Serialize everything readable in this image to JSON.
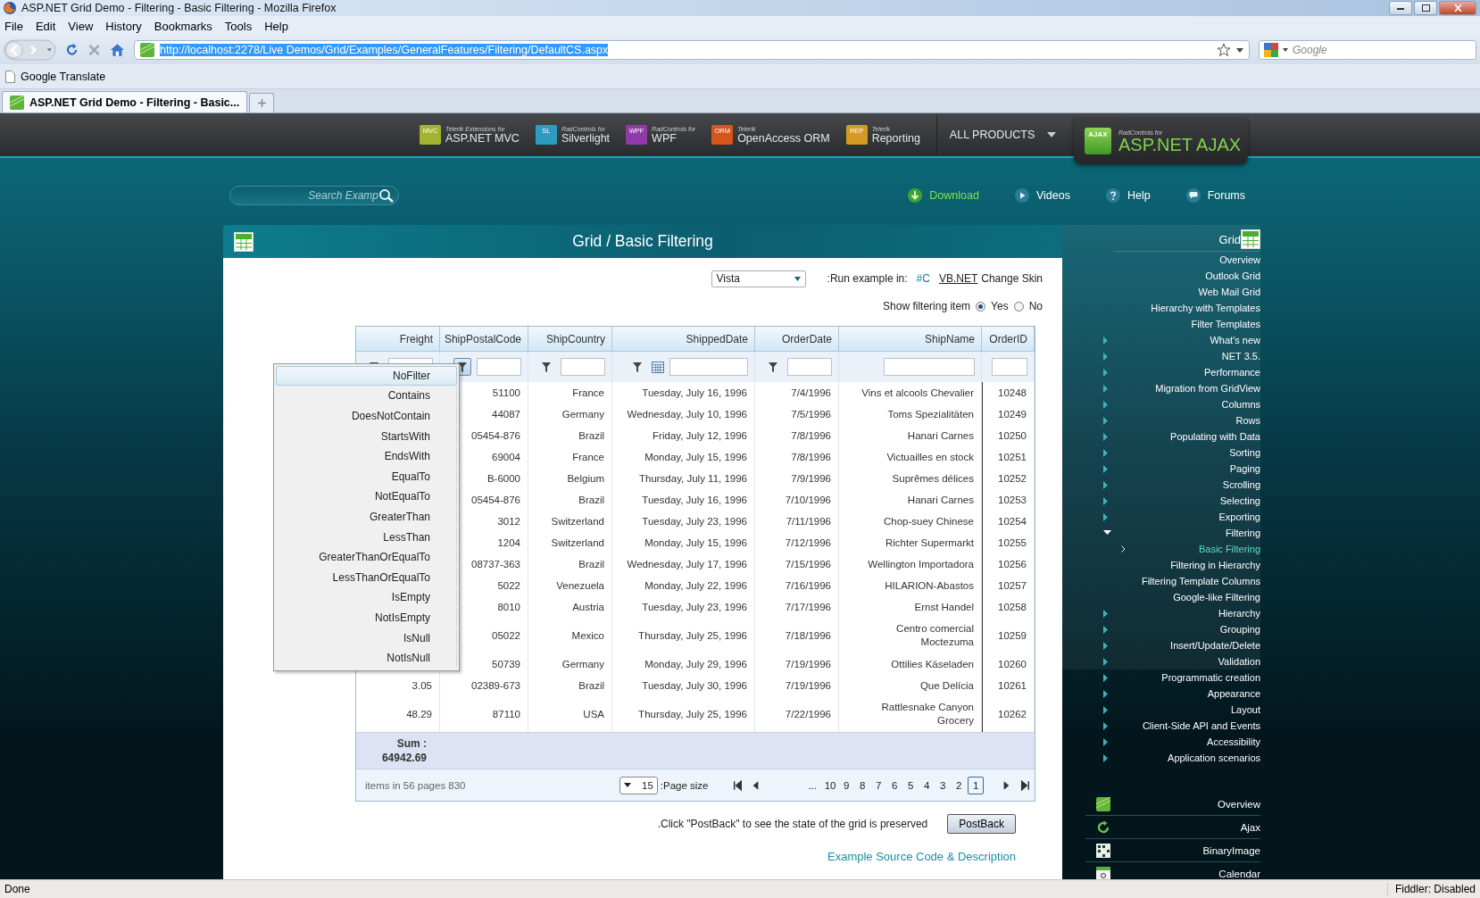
{
  "browser": {
    "title": "ASP.NET Grid Demo - Filtering - Basic Filtering - Mozilla Firefox",
    "menu": [
      "File",
      "Edit",
      "View",
      "History",
      "Bookmarks",
      "Tools",
      "Help"
    ],
    "url": "http://localhost:2278/Live Demos/Grid/Examples/GeneralFeatures/Filtering/DefaultCS.aspx",
    "search_placeholder": "Google",
    "bookmarks": [
      "Google Translate"
    ],
    "tabs": [
      {
        "label": "ASP.NET Grid Demo - Filtering - Basic...",
        "selected": true
      }
    ],
    "status": "Done",
    "status_right": "Fiddler: Disabled"
  },
  "products": [
    {
      "badge": "MVC",
      "color": "#a3b530",
      "caption": "Telerik Extensions for",
      "name": "ASP.NET MVC"
    },
    {
      "badge": "SL",
      "color": "#2e9cc0",
      "caption": "RadControls for",
      "name": "Silverlight"
    },
    {
      "badge": "WPF",
      "color": "#8f3aa8",
      "caption": "RadControls for",
      "name": "WPF"
    },
    {
      "badge": "ORM",
      "color": "#d5561c",
      "caption": "Telerik",
      "name": "OpenAccess ORM"
    },
    {
      "badge": "REP",
      "color": "#d49a22",
      "caption": "Telerik",
      "name": "Reporting"
    }
  ],
  "all_products": "ALL PRODUCTS",
  "brand": {
    "badge": "AJAX",
    "caption": "RadControls for",
    "name": "ASP.NET AJAX"
  },
  "search": {
    "placeholder": "Search Examp"
  },
  "links": [
    {
      "label": "Download",
      "kind": "download"
    },
    {
      "label": "Videos",
      "kind": "videos"
    },
    {
      "label": "Help",
      "kind": "help"
    },
    {
      "label": "Forums",
      "kind": "forums"
    }
  ],
  "panel": {
    "title": "Grid / Basic Filtering",
    "skin": "Vista",
    "run_label": ":Run example in:",
    "languages": [
      {
        "label": "#C",
        "selected": true
      },
      {
        "label": "VB.NET",
        "selected": false
      }
    ],
    "change_skin": "Change Skin",
    "filter_label": "Show filtering item",
    "filter_options": [
      {
        "label": "Yes",
        "selected": true
      },
      {
        "label": "No",
        "selected": false
      }
    ]
  },
  "grid": {
    "columns": [
      "Freight",
      "ShipPostalCode",
      "ShipCountry",
      "ShippedDate",
      "OrderDate",
      "ShipName",
      "OrderID"
    ],
    "filters": [
      {
        "kind": "text",
        "active": false
      },
      {
        "kind": "text",
        "active": true
      },
      {
        "kind": "text",
        "active": false
      },
      {
        "kind": "date",
        "active": false
      },
      {
        "kind": "text",
        "active": false
      },
      {
        "kind": "plain"
      },
      {
        "kind": "plain"
      }
    ],
    "rows": [
      {
        "ship_postal_code": "51100",
        "ship_country": "France",
        "shipped_date": "Tuesday, July 16, 1996",
        "order_date": "7/4/1996",
        "ship_name": "Vins et alcools Chevalier",
        "order_id": "10248"
      },
      {
        "ship_postal_code": "44087",
        "ship_country": "Germany",
        "shipped_date": "Wednesday, July 10, 1996",
        "order_date": "7/5/1996",
        "ship_name": "Toms Spezialitäten",
        "order_id": "10249"
      },
      {
        "ship_postal_code": "05454-876",
        "ship_country": "Brazil",
        "shipped_date": "Friday, July 12, 1996",
        "order_date": "7/8/1996",
        "ship_name": "Hanari Carnes",
        "order_id": "10250"
      },
      {
        "ship_postal_code": "69004",
        "ship_country": "France",
        "shipped_date": "Monday, July 15, 1996",
        "order_date": "7/8/1996",
        "ship_name": "Victuailles en stock",
        "order_id": "10251"
      },
      {
        "ship_postal_code": "B-6000",
        "ship_country": "Belgium",
        "shipped_date": "Thursday, July 11, 1996",
        "order_date": "7/9/1996",
        "ship_name": "Suprêmes délices",
        "order_id": "10252"
      },
      {
        "ship_postal_code": "05454-876",
        "ship_country": "Brazil",
        "shipped_date": "Tuesday, July 16, 1996",
        "order_date": "7/10/1996",
        "ship_name": "Hanari Carnes",
        "order_id": "10253"
      },
      {
        "ship_postal_code": "3012",
        "ship_country": "Switzerland",
        "shipped_date": "Tuesday, July 23, 1996",
        "order_date": "7/11/1996",
        "ship_name": "Chop-suey Chinese",
        "order_id": "10254"
      },
      {
        "ship_postal_code": "1204",
        "ship_country": "Switzerland",
        "shipped_date": "Monday, July 15, 1996",
        "order_date": "7/12/1996",
        "ship_name": "Richter Supermarkt",
        "order_id": "10255"
      },
      {
        "ship_postal_code": "08737-363",
        "ship_country": "Brazil",
        "shipped_date": "Wednesday, July 17, 1996",
        "order_date": "7/15/1996",
        "ship_name": "Wellington Importadora",
        "order_id": "10256"
      },
      {
        "ship_postal_code": "5022",
        "ship_country": "Venezuela",
        "shipped_date": "Monday, July 22, 1996",
        "order_date": "7/16/1996",
        "ship_name": "HILARION-Abastos",
        "order_id": "10257"
      },
      {
        "ship_postal_code": "8010",
        "ship_country": "Austria",
        "shipped_date": "Tuesday, July 23, 1996",
        "order_date": "7/17/1996",
        "ship_name": "Ernst Handel",
        "order_id": "10258"
      },
      {
        "ship_postal_code": "05022",
        "ship_country": "Mexico",
        "shipped_date": "Thursday, July 25, 1996",
        "order_date": "7/18/1996",
        "ship_name": "Centro comercial Moctezuma",
        "order_id": "10259"
      },
      {
        "ship_postal_code": "50739",
        "ship_country": "Germany",
        "shipped_date": "Monday, July 29, 1996",
        "order_date": "7/19/1996",
        "ship_name": "Ottilies Käseladen",
        "order_id": "10260"
      },
      {
        "freight": "3.05",
        "ship_postal_code": "02389-673",
        "ship_country": "Brazil",
        "shipped_date": "Tuesday, July 30, 1996",
        "order_date": "7/19/1996",
        "ship_name": "Que Delícia",
        "order_id": "10261"
      },
      {
        "freight": "48.29",
        "ship_postal_code": "87110",
        "ship_country": "USA",
        "shipped_date": "Thursday, July 25, 1996",
        "order_date": "7/22/1996",
        "ship_name": "Rattlesnake Canyon Grocery",
        "order_id": "10262"
      }
    ],
    "sum": {
      "label": "Sum :",
      "value": "64942.69"
    },
    "pager": {
      "summary": "items in 56 pages 830",
      "page_size": "15",
      "page_size_label": ":Page size",
      "ellipsis": "...",
      "pages": [
        {
          "label": "10",
          "selected": false
        },
        {
          "label": "9",
          "selected": false
        },
        {
          "label": "8",
          "selected": false
        },
        {
          "label": "7",
          "selected": false
        },
        {
          "label": "6",
          "selected": false
        },
        {
          "label": "5",
          "selected": false
        },
        {
          "label": "4",
          "selected": false
        },
        {
          "label": "3",
          "selected": false
        },
        {
          "label": "2",
          "selected": false
        },
        {
          "label": "1",
          "selected": true
        }
      ]
    }
  },
  "filter_menu": [
    {
      "label": "NoFilter",
      "selected": true
    },
    {
      "label": "Contains",
      "selected": false
    },
    {
      "label": "DoesNotContain",
      "selected": false
    },
    {
      "label": "StartsWith",
      "selected": false
    },
    {
      "label": "EndsWith",
      "selected": false
    },
    {
      "label": "EqualTo",
      "selected": false
    },
    {
      "label": "NotEqualTo",
      "selected": false
    },
    {
      "label": "GreaterThan",
      "selected": false
    },
    {
      "label": "LessThan",
      "selected": false
    },
    {
      "label": "GreaterThanOrEqualTo",
      "selected": false
    },
    {
      "label": "LessThanOrEqualTo",
      "selected": false
    },
    {
      "label": "IsEmpty",
      "selected": false
    },
    {
      "label": "NotIsEmpty",
      "selected": false
    },
    {
      "label": "IsNull",
      "selected": false
    },
    {
      "label": "NotIsNull",
      "selected": false
    }
  ],
  "postback": {
    "text": ".Click \"PostBack\" to see the state of the grid is preserved",
    "button": "PostBack"
  },
  "source_link": "Example Source Code & Description",
  "sidebar": {
    "title": "Grid",
    "items": [
      {
        "label": "Overview",
        "kind": "leaf",
        "selected": false
      },
      {
        "label": "Outlook Grid",
        "kind": "leaf",
        "selected": false
      },
      {
        "label": "Web Mail Grid",
        "kind": "leaf",
        "selected": false
      },
      {
        "label": "Hierarchy with Templates",
        "kind": "leaf",
        "selected": false
      },
      {
        "label": "Filter Templates",
        "kind": "leaf",
        "selected": false
      },
      {
        "label": "What's new",
        "kind": "group",
        "expanded": false,
        "selected": false
      },
      {
        "label": "NET 3.5.",
        "kind": "group",
        "expanded": false,
        "selected": false
      },
      {
        "label": "Performance",
        "kind": "group",
        "expanded": false,
        "selected": false
      },
      {
        "label": "Migration from GridView",
        "kind": "group",
        "expanded": false,
        "selected": false
      },
      {
        "label": "Columns",
        "kind": "group",
        "expanded": false,
        "selected": false
      },
      {
        "label": "Rows",
        "kind": "group",
        "expanded": false,
        "selected": false
      },
      {
        "label": "Populating with Data",
        "kind": "group",
        "expanded": false,
        "selected": false
      },
      {
        "label": "Sorting",
        "kind": "group",
        "expanded": false,
        "selected": false
      },
      {
        "label": "Paging",
        "kind": "group",
        "expanded": false,
        "selected": false
      },
      {
        "label": "Scrolling",
        "kind": "group",
        "expanded": false,
        "selected": false
      },
      {
        "label": "Selecting",
        "kind": "group",
        "expanded": false,
        "selected": false
      },
      {
        "label": "Exporting",
        "kind": "group",
        "expanded": false,
        "selected": false
      },
      {
        "label": "Filtering",
        "kind": "group",
        "expanded": true,
        "selected": false,
        "children": [
          {
            "label": "Basic Filtering",
            "selected": true
          },
          {
            "label": "Filtering in Hierarchy",
            "selected": false
          },
          {
            "label": "Filtering Template Columns",
            "selected": false
          },
          {
            "label": "Google-like Filtering",
            "selected": false
          }
        ]
      },
      {
        "label": "Hierarchy",
        "kind": "group",
        "expanded": false,
        "selected": false
      },
      {
        "label": "Grouping",
        "kind": "group",
        "expanded": false,
        "selected": false
      },
      {
        "label": "Insert/Update/Delete",
        "kind": "group",
        "expanded": false,
        "selected": false
      },
      {
        "label": "Validation",
        "kind": "group",
        "expanded": false,
        "selected": false
      }
    ],
    "more_items": [
      {
        "label": "Programmatic creation",
        "kind": "group",
        "expanded": false,
        "selected": false
      },
      {
        "label": "Appearance",
        "kind": "group",
        "expanded": false,
        "selected": false
      },
      {
        "label": "Layout",
        "kind": "group",
        "expanded": false,
        "selected": false
      },
      {
        "label": "Client-Side API and Events",
        "kind": "group",
        "expanded": false,
        "selected": false
      },
      {
        "label": "Accessibility",
        "kind": "group",
        "expanded": false,
        "selected": false
      },
      {
        "label": "Application scenarios",
        "kind": "group",
        "expanded": false,
        "selected": false
      }
    ],
    "controls": [
      {
        "label": "Overview",
        "kind": "overview"
      },
      {
        "label": "Ajax",
        "kind": "ajax"
      },
      {
        "label": "BinaryImage",
        "kind": "binaryimage"
      },
      {
        "label": "Calendar",
        "kind": "calendar"
      }
    ]
  }
}
